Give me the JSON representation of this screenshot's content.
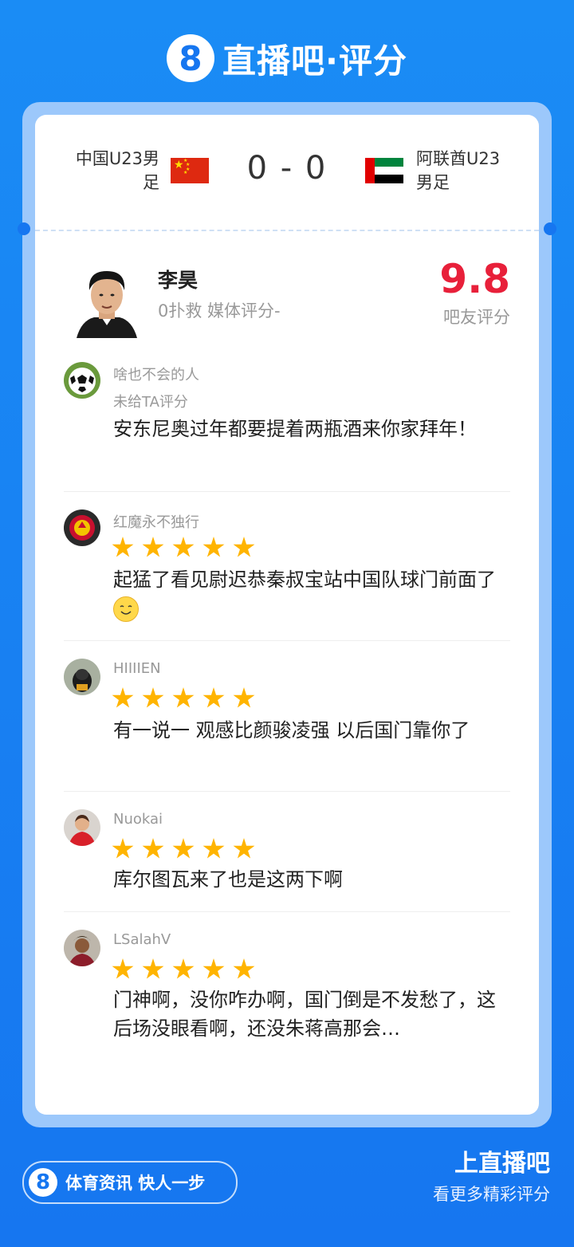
{
  "header": {
    "logo_glyph": "8",
    "title": "直播吧·评分"
  },
  "match": {
    "home_team": "中国U23男足",
    "away_team": "阿联酋U23男足",
    "score": "0 - 0",
    "home_flag": "china-flag",
    "away_flag": "uae-flag"
  },
  "player": {
    "name": "李昊",
    "stats": "0扑救 媒体评分-",
    "score": "9.8",
    "score_label": "吧友评分"
  },
  "comments": [
    {
      "user": "啥也不会的人",
      "rating_text": "未给TA评分",
      "stars": 0,
      "text": "安东尼奥过年都要提着两瓶酒来你家拜年！"
    },
    {
      "user": "红魔永不独行",
      "rating_text": "",
      "stars": 5,
      "text": "起猛了看见尉迟恭秦叔宝站中国队球门前面了"
    },
    {
      "user": "HIIIIEN",
      "rating_text": "",
      "stars": 5,
      "text": "有一说一 观感比颜骏凌强 以后国门靠你了"
    },
    {
      "user": "Nuokai",
      "rating_text": "",
      "stars": 5,
      "text": "库尔图瓦来了也是这两下啊"
    },
    {
      "user": "LSalahV",
      "rating_text": "",
      "stars": 5,
      "text": "门神啊，没你咋办啊，国门倒是不发愁了，这后场没眼看啊，还没朱蒋高那会…"
    }
  ],
  "footer": {
    "badge_glyph": "8",
    "badge_text": "体育资讯 快人一步",
    "cta_title": "上直播吧",
    "cta_sub": "看更多精彩评分"
  },
  "colors": {
    "brand": "#1676f0",
    "score": "#e8203a",
    "star": "#ffb400"
  }
}
